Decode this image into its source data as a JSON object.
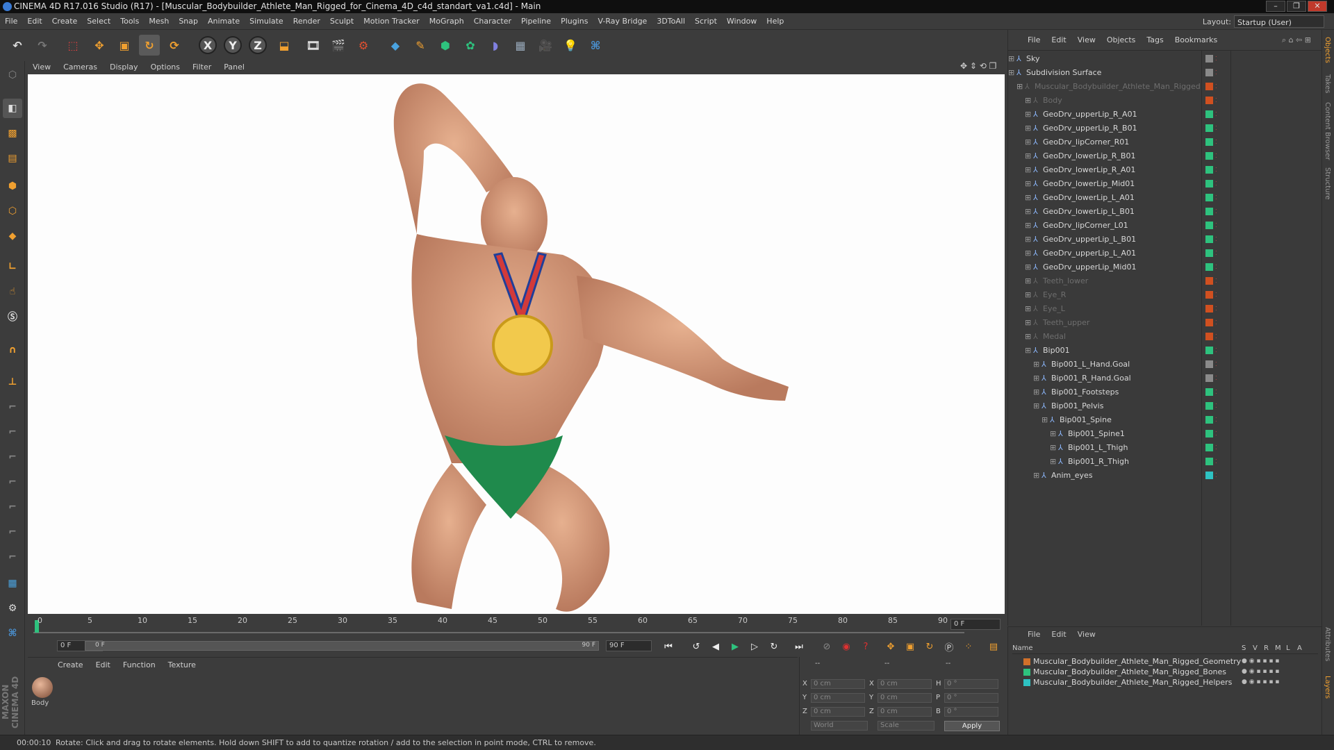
{
  "window": {
    "title": "CINEMA 4D R17.016 Studio (R17) - [Muscular_Bodybuilder_Athlete_Man_Rigged_for_Cinema_4D_c4d_standart_va1.c4d] - Main",
    "controls": [
      "–",
      "❐",
      "✕"
    ]
  },
  "menubar": {
    "items": [
      "File",
      "Edit",
      "Create",
      "Select",
      "Tools",
      "Mesh",
      "Snap",
      "Animate",
      "Simulate",
      "Render",
      "Sculpt",
      "Motion Tracker",
      "MoGraph",
      "Character",
      "Pipeline",
      "Plugins",
      "V-Ray Bridge",
      "3DToAll",
      "Script",
      "Window",
      "Help"
    ],
    "layout_label": "Layout:",
    "layout_value": "Startup (User)"
  },
  "toolbar": {
    "axis_x": "X",
    "axis_y": "Y",
    "axis_z": "Z"
  },
  "left_tools": {
    "maxon_label": "MAXON CINEMA 4D"
  },
  "viewport": {
    "menu": [
      "View",
      "Cameras",
      "Display",
      "Options",
      "Filter",
      "Panel"
    ]
  },
  "timeline": {
    "ticks": [
      "0",
      "5",
      "10",
      "15",
      "20",
      "25",
      "30",
      "35",
      "40",
      "45",
      "50",
      "55",
      "60",
      "65",
      "70",
      "75",
      "80",
      "85",
      "90"
    ],
    "current_frame_box": "0 F",
    "start_field": "0 F",
    "range_start": "0 F",
    "range_end": "90 F",
    "end_field": "90 F"
  },
  "materials": {
    "menu": [
      "Create",
      "Edit",
      "Function",
      "Texture"
    ],
    "items": [
      {
        "name": "Body"
      }
    ]
  },
  "coordinates": {
    "header_dashes": [
      "--",
      "--",
      "--"
    ],
    "rows": [
      {
        "a": "X",
        "av": "0 cm",
        "b": "X",
        "bv": "0 cm",
        "c": "H",
        "cv": "0 °"
      },
      {
        "a": "Y",
        "av": "0 cm",
        "b": "Y",
        "bv": "0 cm",
        "c": "P",
        "cv": "0 °"
      },
      {
        "a": "Z",
        "av": "0 cm",
        "b": "Z",
        "bv": "0 cm",
        "c": "B",
        "cv": "0 °"
      }
    ],
    "mode1": "World",
    "mode2": "Scale",
    "apply": "Apply"
  },
  "status": {
    "time": "00:00:10",
    "message": "Rotate: Click and drag to rotate elements. Hold down SHIFT to add to quantize rotation / add to the selection in point mode, CTRL to remove."
  },
  "objects": {
    "menu": [
      "File",
      "Edit",
      "View",
      "Objects",
      "Tags",
      "Bookmarks"
    ],
    "rows": [
      {
        "label": "Sky",
        "indent": 0,
        "dim": false,
        "swatch": "#8a8a8a"
      },
      {
        "label": "Subdivision Surface",
        "indent": 0,
        "dim": false,
        "swatch": "#8a8a8a"
      },
      {
        "label": "Muscular_Bodybuilder_Athlete_Man_Rigged",
        "indent": 1,
        "dim": true,
        "swatch": "#d05020"
      },
      {
        "label": "Body",
        "indent": 2,
        "dim": true,
        "swatch": "#d05020"
      },
      {
        "label": "GeoDrv_upperLip_R_A01",
        "indent": 2,
        "dim": false,
        "swatch": "#2ec27e"
      },
      {
        "label": "GeoDrv_upperLip_R_B01",
        "indent": 2,
        "dim": false,
        "swatch": "#2ec27e"
      },
      {
        "label": "GeoDrv_lipCorner_R01",
        "indent": 2,
        "dim": false,
        "swatch": "#2ec27e"
      },
      {
        "label": "GeoDrv_lowerLip_R_B01",
        "indent": 2,
        "dim": false,
        "swatch": "#2ec27e"
      },
      {
        "label": "GeoDrv_lowerLip_R_A01",
        "indent": 2,
        "dim": false,
        "swatch": "#2ec27e"
      },
      {
        "label": "GeoDrv_lowerLip_Mid01",
        "indent": 2,
        "dim": false,
        "swatch": "#2ec27e"
      },
      {
        "label": "GeoDrv_lowerLip_L_A01",
        "indent": 2,
        "dim": false,
        "swatch": "#2ec27e"
      },
      {
        "label": "GeoDrv_lowerLip_L_B01",
        "indent": 2,
        "dim": false,
        "swatch": "#2ec27e"
      },
      {
        "label": "GeoDrv_lipCorner_L01",
        "indent": 2,
        "dim": false,
        "swatch": "#2ec27e"
      },
      {
        "label": "GeoDrv_upperLip_L_B01",
        "indent": 2,
        "dim": false,
        "swatch": "#2ec27e"
      },
      {
        "label": "GeoDrv_upperLip_L_A01",
        "indent": 2,
        "dim": false,
        "swatch": "#2ec27e"
      },
      {
        "label": "GeoDrv_upperLip_Mid01",
        "indent": 2,
        "dim": false,
        "swatch": "#2ec27e"
      },
      {
        "label": "Teeth_lower",
        "indent": 2,
        "dim": true,
        "swatch": "#d05020"
      },
      {
        "label": "Eye_R",
        "indent": 2,
        "dim": true,
        "swatch": "#d05020"
      },
      {
        "label": "Eye_L",
        "indent": 2,
        "dim": true,
        "swatch": "#d05020"
      },
      {
        "label": "Teeth_upper",
        "indent": 2,
        "dim": true,
        "swatch": "#d05020"
      },
      {
        "label": "Medal",
        "indent": 2,
        "dim": true,
        "swatch": "#d05020"
      },
      {
        "label": "Bip001",
        "indent": 2,
        "dim": false,
        "swatch": "#2ec27e"
      },
      {
        "label": "Bip001_L_Hand.Goal",
        "indent": 3,
        "dim": false,
        "swatch": "#8a8a8a"
      },
      {
        "label": "Bip001_R_Hand.Goal",
        "indent": 3,
        "dim": false,
        "swatch": "#8a8a8a"
      },
      {
        "label": "Bip001_Footsteps",
        "indent": 3,
        "dim": false,
        "swatch": "#2ec27e"
      },
      {
        "label": "Bip001_Pelvis",
        "indent": 3,
        "dim": false,
        "swatch": "#2ec27e"
      },
      {
        "label": "Bip001_Spine",
        "indent": 4,
        "dim": false,
        "swatch": "#2ec27e"
      },
      {
        "label": "Bip001_Spine1",
        "indent": 5,
        "dim": false,
        "swatch": "#2ec27e"
      },
      {
        "label": "Bip001_L_Thigh",
        "indent": 5,
        "dim": false,
        "swatch": "#2ec27e"
      },
      {
        "label": "Bip001_R_Thigh",
        "indent": 5,
        "dim": false,
        "swatch": "#2ec27e"
      },
      {
        "label": "Anim_eyes",
        "indent": 3,
        "dim": false,
        "swatch": "#2ec2c2"
      }
    ]
  },
  "layers": {
    "menu": [
      "File",
      "Edit",
      "View"
    ],
    "header_name": "Name",
    "header_cols": [
      "S",
      "V",
      "R",
      "M",
      "L",
      "A"
    ],
    "rows": [
      {
        "name": "Muscular_Bodybuilder_Athlete_Man_Rigged_Geometry",
        "color": "#d0702a"
      },
      {
        "name": "Muscular_Bodybuilder_Athlete_Man_Rigged_Bones",
        "color": "#2ec27e"
      },
      {
        "name": "Muscular_Bodybuilder_Athlete_Man_Rigged_Helpers",
        "color": "#2ec2c2"
      }
    ]
  },
  "right_tabs": [
    "Objects",
    "Takes",
    "Content Browser",
    "Structure",
    "Attributes",
    "Layers"
  ]
}
